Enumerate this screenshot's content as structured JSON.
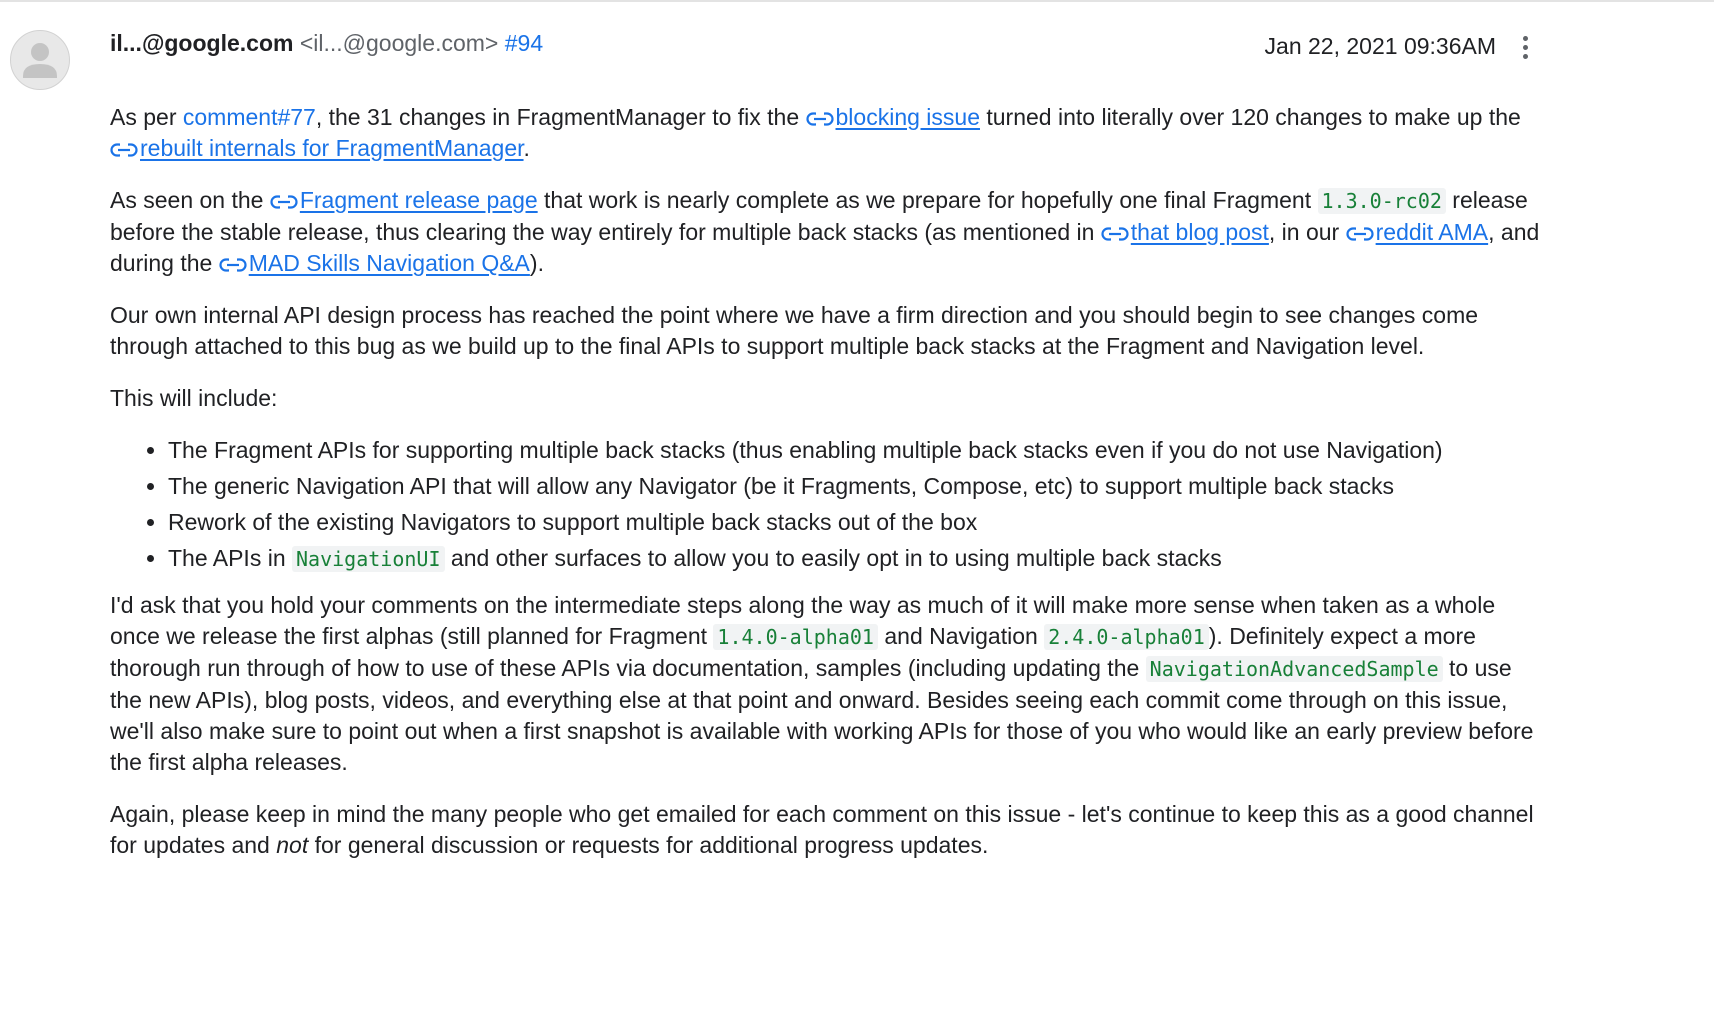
{
  "icons": {
    "avatar": "avatar-placeholder-icon",
    "link": "link-icon",
    "menu": "more-vert-icon"
  },
  "colors": {
    "link": "#1a73e8",
    "code": "#188038",
    "code_background": "#f1f3f4",
    "muted": "#5f6368"
  },
  "comment": {
    "author": {
      "name": "il...@google.com",
      "email": "<il...@google.com>"
    },
    "number": "#94",
    "timestamp": "Jan 22, 2021 09:36AM",
    "p1": {
      "t1": "As per ",
      "link1": "comment#77",
      "t2": ", the 31 changes in FragmentManager to fix the ",
      "link2": "blocking issue",
      "t3": " turned into literally over 120 changes to make up the ",
      "link3": "rebuilt internals for FragmentManager",
      "t4": "."
    },
    "p2": {
      "t1": "As seen on the ",
      "link1": "Fragment release page",
      "t2": " that work is nearly complete as we prepare for hopefully one final Fragment ",
      "code1": "1.3.0-rc02",
      "t3": " release before the stable release, thus clearing the way entirely for multiple back stacks (as mentioned in ",
      "link2": "that blog post",
      "t4": ", in our ",
      "link3": "reddit AMA",
      "t5": ", and during the ",
      "link4": "MAD Skills Navigation Q&A",
      "t6": ")."
    },
    "p3": "Our own internal API design process has reached the point where we have a firm direction and you should begin to see changes come through attached to this bug as we build up to the final APIs to support multiple back stacks at the Fragment and Navigation level.",
    "p4": "This will include:",
    "list": {
      "item1": "The Fragment APIs for supporting multiple back stacks (thus enabling multiple back stacks even if you do not use Navigation)",
      "item2": "The generic Navigation API that will allow any Navigator (be it Fragments, Compose, etc) to support multiple back stacks",
      "item3": "Rework of the existing Navigators to support multiple back stacks out of the box",
      "item4": {
        "t1": "The APIs in ",
        "code1": "NavigationUI",
        "t2": " and other surfaces to allow you to easily opt in to using multiple back stacks"
      }
    },
    "p5": {
      "t1": "I'd ask that you hold your comments on the intermediate steps along the way as much of it will make more sense when taken as a whole once we release the first alphas (still planned for Fragment ",
      "code1": "1.4.0-alpha01",
      "t2": " and Navigation ",
      "code2": "2.4.0-alpha01",
      "t3": "). Definitely expect a more thorough run through of how to use of these APIs via documentation, samples (including updating the ",
      "code3": "NavigationAdvancedSample",
      "t4": " to use the new APIs), blog posts, videos, and everything else at that point and onward. Besides seeing each commit come through on this issue, we'll also make sure to point out when a first snapshot is available with working APIs for those of you who would like an early preview before the first alpha releases."
    },
    "p6": {
      "t1": "Again, please keep in mind the many people who get emailed for each comment on this issue - let's continue to keep this as a good channel for updates and ",
      "em1": "not",
      "t2": " for general discussion or requests for additional progress updates."
    }
  }
}
